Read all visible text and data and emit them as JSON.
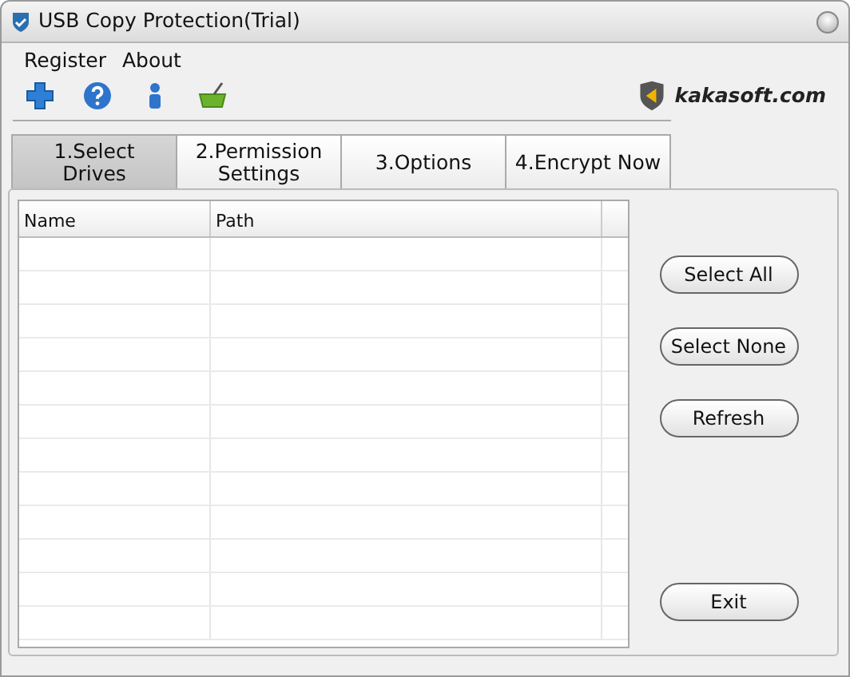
{
  "window": {
    "title": "USB Copy Protection(Trial)"
  },
  "menu": [
    "Register",
    "About"
  ],
  "logo_text": "kakasoft.com",
  "tabs": [
    {
      "label": "1.Select Drives",
      "selected": true
    },
    {
      "label": "2.Permission Settings",
      "selected": false
    },
    {
      "label": "3.Options",
      "selected": false
    },
    {
      "label": "4.Encrypt Now",
      "selected": false
    }
  ],
  "table": {
    "columns": [
      "Name",
      "Path"
    ]
  },
  "buttons": [
    "Select All",
    "Select None",
    "Refresh",
    "Exit"
  ]
}
